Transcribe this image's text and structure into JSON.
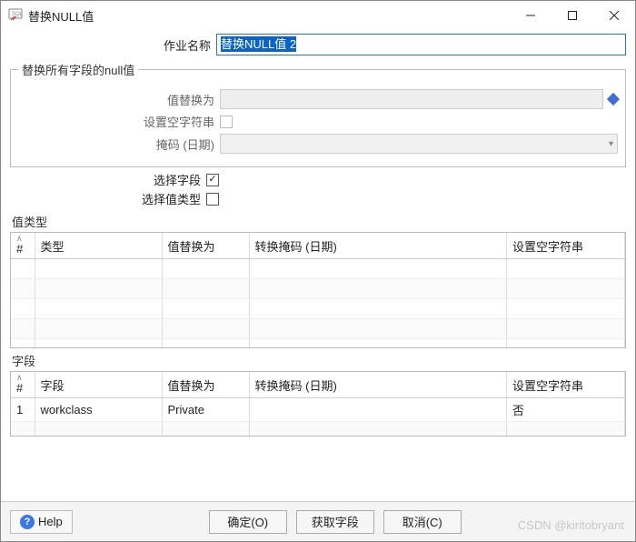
{
  "window": {
    "title": "替换NULL值"
  },
  "job": {
    "name_label": "作业名称",
    "name_value": "替换NULL值 2"
  },
  "group_all_fields": {
    "legend": "替换所有字段的null值",
    "replace_with_label": "值替换为",
    "set_empty_label": "设置空字符串",
    "mask_date_label": "掩码 (日期)"
  },
  "mid_checks": {
    "select_field_label": "选择字段",
    "select_field_checked": true,
    "select_value_type_label": "选择值类型",
    "select_value_type_checked": false
  },
  "value_types": {
    "section_label": "值类型",
    "columns": {
      "num": "#",
      "type": "类型",
      "replace_with": "值替换为",
      "convert_mask": "转换掩码 (日期)",
      "set_empty": "设置空字符串"
    },
    "rows": []
  },
  "fields": {
    "section_label": "字段",
    "columns": {
      "num": "#",
      "field": "字段",
      "replace_with": "值替换为",
      "convert_mask": "转换掩码 (日期)",
      "set_empty": "设置空字符串"
    },
    "rows": [
      {
        "num": "1",
        "field": "workclass",
        "replace_with": "Private",
        "convert_mask": "",
        "set_empty": "否"
      }
    ]
  },
  "footer": {
    "help": "Help",
    "ok": "确定(O)",
    "get_fields": "获取字段",
    "cancel": "取消(C)"
  },
  "watermark": "CSDN @kiritobryant"
}
